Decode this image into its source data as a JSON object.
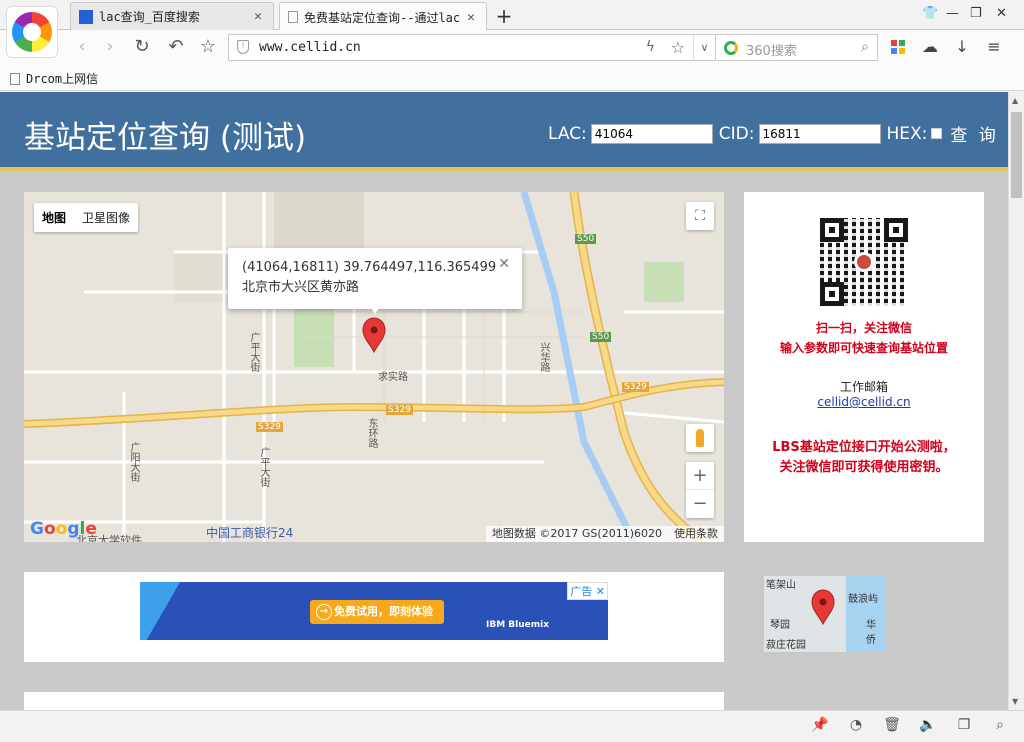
{
  "browser": {
    "tabs": [
      {
        "title": "lac查询_百度搜索",
        "active": false
      },
      {
        "title": "免费基站定位查询--通过lac",
        "active": true
      }
    ],
    "new_tab_symbol": "+",
    "url": "www.cellid.cn",
    "search_placeholder": "360搜索",
    "bookmark": "Drcom上网信"
  },
  "header": {
    "title": "基站定位查询 (测试)",
    "lac_label": "LAC:",
    "lac_value": "41064",
    "cid_label": "CID:",
    "cid_value": "16811",
    "hex_label": "HEX:",
    "query_button": "查 询"
  },
  "map": {
    "type_map": "地图",
    "type_satellite": "卫星图像",
    "popup_line1": "(41064,16811) 39.764497,116.365499",
    "popup_line2": "北京市大兴区黄亦路",
    "attribution": "地图数据 ©2017 GS(2011)6020",
    "terms": "使用条款",
    "google": "Google",
    "labels": {
      "s50a": "S50",
      "s50b": "S50",
      "s329a": "S329",
      "s329b": "S329",
      "s329c": "S329",
      "guangping": "广平大街",
      "guangping2": "广平大街",
      "guangyang": "广阳大街",
      "dongcheng": "东环路",
      "qiushi": "求实路",
      "xinghua": "兴华路",
      "icbc": "中国工商银行24",
      "daxue": "北京大学软件"
    },
    "zoom_in": "+",
    "zoom_out": "−"
  },
  "sidebar": {
    "scan_text": "扫一扫，关注微信",
    "scan_text2": "输入参数即可快速查询基站位置",
    "email_label": "工作邮箱",
    "email": "cellid@cellid.cn",
    "lbs_line1": "LBS基站定位接口开始公测啦，",
    "lbs_line2": "关注微信即可获得使用密钥。"
  },
  "ad": {
    "tag": "广告",
    "cta": "免费试用，即刻体验",
    "brand": "IBM Bluemix"
  },
  "minimap": {
    "labels": [
      "笔架山",
      "鼓浪屿",
      "琴园",
      "华侨",
      "菽庄花园"
    ]
  }
}
